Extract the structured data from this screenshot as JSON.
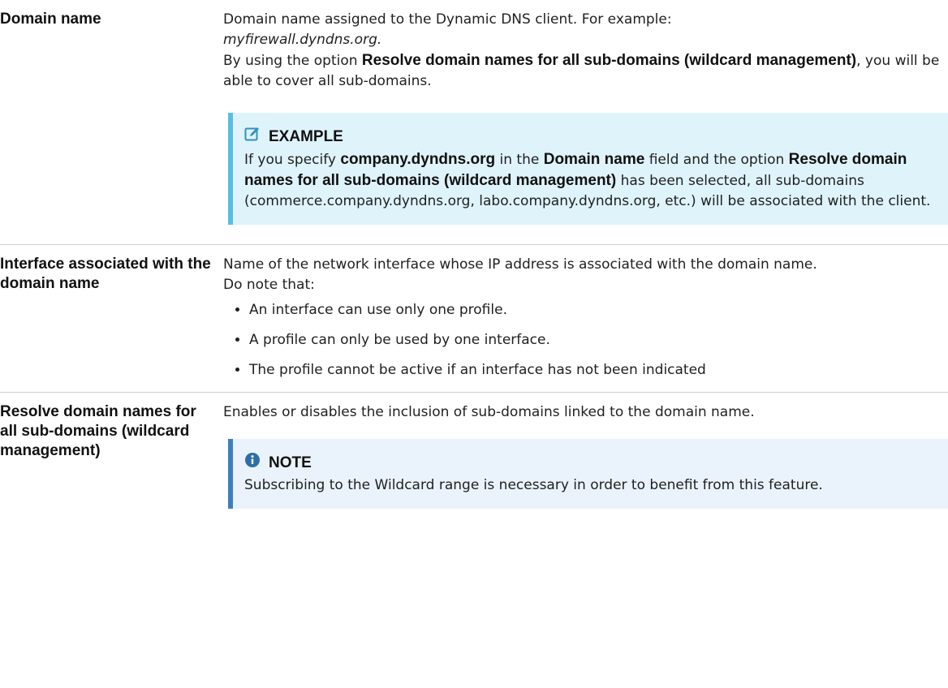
{
  "rows": [
    {
      "term": "Domain name",
      "line1": "Domain name assigned to the Dynamic DNS client. For example:",
      "example_value": "myfirewall.dyndns.org.",
      "l3_pre": "By using the option ",
      "l3_bold": "Resolve domain names for all sub-domains (wildcard management)",
      "l3_post": ", you will be able to cover all sub-domains.",
      "box": {
        "icon": "edit-icon",
        "title": "EXAMPLE",
        "t1": "If you specify ",
        "b1": "company.dyndns.org",
        "t2": " in the ",
        "b2": "Domain name",
        "t3": " field and the option ",
        "b3": "Resolve domain names for all sub-domains (wildcard management)",
        "t4": " has been selected, all sub-domains (commerce.company.dyndns.org, labo.company.dyndns.org, etc.) will be associated with the client."
      }
    },
    {
      "term": "Interface associated with the domain name",
      "line1": "Name of the network interface whose IP address is associated with the domain name.",
      "line2": "Do note that:",
      "bullets": [
        "An interface can use only one profile.",
        "A profile can only be used by one interface.",
        "The profile cannot be active if an interface has not been indicated"
      ]
    },
    {
      "term": "Resolve domain names for all sub-domains (wildcard management)",
      "line1": "Enables or disables the inclusion of sub-domains linked to the domain name.",
      "box": {
        "icon": "info-icon",
        "title": "NOTE",
        "text": "Subscribing to the Wildcard range is necessary in order to benefit from this feature."
      }
    }
  ],
  "colors": {
    "example_bg": "#dff3fb",
    "example_border": "#57bde3",
    "note_bg": "#eaf3fb",
    "note_border": "#3d7fbf"
  }
}
